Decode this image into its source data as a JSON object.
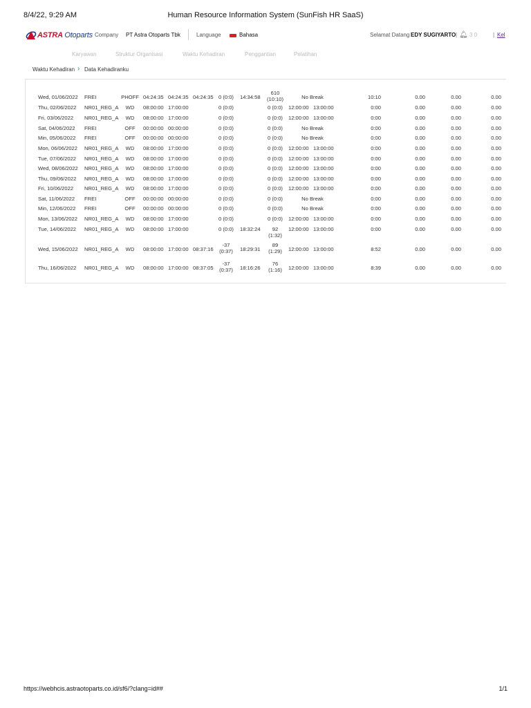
{
  "print": {
    "datetime": "8/4/22, 9:29 AM",
    "title": "Human Resource Information System (SunFish HR SaaS)",
    "url": "https://webhcis.astraotoparts.co.id/sf6/?clang=id##",
    "page": "1/1"
  },
  "header": {
    "logo_brand": "ASTRA",
    "logo_product": "Otoparts",
    "company_label": "Company",
    "company_value": "PT Astra Otoparts Tbk",
    "language_label": "Language",
    "language_value": "Bahasa",
    "welcome_label": "Selamat Datang",
    "user_name": "EDY SUGIYARTO",
    "notification_count": "3 0",
    "logout_label": "Kel"
  },
  "nav": {
    "items": [
      "Karyawan",
      "Struktur Organisasi",
      "Waktu Kehadiran",
      "Penggantian",
      "Pelatihan"
    ]
  },
  "breadcrumb": {
    "parent": "Waktu Kehadiran",
    "current": "Data Kehadiranku"
  },
  "attendance": {
    "rows": [
      {
        "date": "Wed, 01/06/2022",
        "shift": "FREI",
        "type": "PHOFF",
        "start": "04:24:35",
        "end": "04:24:35",
        "in": "04:24:35",
        "late": "0 (0:0)",
        "out": "14:34:58",
        "early_1": "610",
        "early_2": "(10:10)",
        "break_start": "No Break",
        "break_end": "",
        "work": "10:10",
        "ot1": "0.00",
        "ot2": "0.00",
        "ot3": "0.00"
      },
      {
        "date": "Thu, 02/06/2022",
        "shift": "NR01_REG_A",
        "type": "WD",
        "start": "08:00:00",
        "end": "17:00:00",
        "in": "",
        "late": "0 (0:0)",
        "out": "",
        "early_1": "0 (0:0)",
        "early_2": "",
        "break_start": "12:00:00",
        "break_end": "13:00:00",
        "work": "0:00",
        "ot1": "0.00",
        "ot2": "0.00",
        "ot3": "0.00"
      },
      {
        "date": "Fri, 03/06/2022",
        "shift": "NR01_REG_A",
        "type": "WD",
        "start": "08:00:00",
        "end": "17:00:00",
        "in": "",
        "late": "0 (0:0)",
        "out": "",
        "early_1": "0 (0:0)",
        "early_2": "",
        "break_start": "12:00:00",
        "break_end": "13:00:00",
        "work": "0:00",
        "ot1": "0.00",
        "ot2": "0.00",
        "ot3": "0.00"
      },
      {
        "date": "Sat, 04/06/2022",
        "shift": "FREI",
        "type": "OFF",
        "start": "00:00:00",
        "end": "00:00:00",
        "in": "",
        "late": "0 (0:0)",
        "out": "",
        "early_1": "0 (0:0)",
        "early_2": "",
        "break_start": "No Break",
        "break_end": "",
        "work": "0:00",
        "ot1": "0.00",
        "ot2": "0.00",
        "ot3": "0.00"
      },
      {
        "date": "Min, 05/06/2022",
        "shift": "FREI",
        "type": "OFF",
        "start": "00:00:00",
        "end": "00:00:00",
        "in": "",
        "late": "0 (0:0)",
        "out": "",
        "early_1": "0 (0:0)",
        "early_2": "",
        "break_start": "No Break",
        "break_end": "",
        "work": "0:00",
        "ot1": "0.00",
        "ot2": "0.00",
        "ot3": "0.00"
      },
      {
        "date": "Mon, 06/06/2022",
        "shift": "NR01_REG_A",
        "type": "WD",
        "start": "08:00:00",
        "end": "17:00:00",
        "in": "",
        "late": "0 (0:0)",
        "out": "",
        "early_1": "0 (0:0)",
        "early_2": "",
        "break_start": "12:00:00",
        "break_end": "13:00:00",
        "work": "0:00",
        "ot1": "0.00",
        "ot2": "0.00",
        "ot3": "0.00"
      },
      {
        "date": "Tue, 07/06/2022",
        "shift": "NR01_REG_A",
        "type": "WD",
        "start": "08:00:00",
        "end": "17:00:00",
        "in": "",
        "late": "0 (0:0)",
        "out": "",
        "early_1": "0 (0:0)",
        "early_2": "",
        "break_start": "12:00:00",
        "break_end": "13:00:00",
        "work": "0:00",
        "ot1": "0.00",
        "ot2": "0.00",
        "ot3": "0.00"
      },
      {
        "date": "Wed, 08/06/2022",
        "shift": "NR01_REG_A",
        "type": "WD",
        "start": "08:00:00",
        "end": "17:00:00",
        "in": "",
        "late": "0 (0:0)",
        "out": "",
        "early_1": "0 (0:0)",
        "early_2": "",
        "break_start": "12:00:00",
        "break_end": "13:00:00",
        "work": "0:00",
        "ot1": "0.00",
        "ot2": "0.00",
        "ot3": "0.00"
      },
      {
        "date": "Thu, 09/06/2022",
        "shift": "NR01_REG_A",
        "type": "WD",
        "start": "08:00:00",
        "end": "17:00:00",
        "in": "",
        "late": "0 (0:0)",
        "out": "",
        "early_1": "0 (0:0)",
        "early_2": "",
        "break_start": "12:00:00",
        "break_end": "13:00:00",
        "work": "0:00",
        "ot1": "0.00",
        "ot2": "0.00",
        "ot3": "0.00"
      },
      {
        "date": "Fri, 10/06/2022",
        "shift": "NR01_REG_A",
        "type": "WD",
        "start": "08:00:00",
        "end": "17:00:00",
        "in": "",
        "late": "0 (0:0)",
        "out": "",
        "early_1": "0 (0:0)",
        "early_2": "",
        "break_start": "12:00:00",
        "break_end": "13:00:00",
        "work": "0:00",
        "ot1": "0.00",
        "ot2": "0.00",
        "ot3": "0.00"
      },
      {
        "date": "Sat, 11/06/2022",
        "shift": "FREI",
        "type": "OFF",
        "start": "00:00:00",
        "end": "00:00:00",
        "in": "",
        "late": "0 (0:0)",
        "out": "",
        "early_1": "0 (0:0)",
        "early_2": "",
        "break_start": "No Break",
        "break_end": "",
        "work": "0:00",
        "ot1": "0.00",
        "ot2": "0.00",
        "ot3": "0.00"
      },
      {
        "date": "Min, 12/06/2022",
        "shift": "FREI",
        "type": "OFF",
        "start": "00:00:00",
        "end": "00:00:00",
        "in": "",
        "late": "0 (0:0)",
        "out": "",
        "early_1": "0 (0:0)",
        "early_2": "",
        "break_start": "No Break",
        "break_end": "",
        "work": "0:00",
        "ot1": "0.00",
        "ot2": "0.00",
        "ot3": "0.00"
      },
      {
        "date": "Mon, 13/06/2022",
        "shift": "NR01_REG_A",
        "type": "WD",
        "start": "08:00:00",
        "end": "17:00:00",
        "in": "",
        "late": "0 (0:0)",
        "out": "",
        "early_1": "0 (0:0)",
        "early_2": "",
        "break_start": "12:00:00",
        "break_end": "13:00:00",
        "work": "0:00",
        "ot1": "0.00",
        "ot2": "0.00",
        "ot3": "0.00"
      },
      {
        "date": "Tue, 14/06/2022",
        "shift": "NR01_REG_A",
        "type": "WD",
        "start": "08:00:00",
        "end": "17:00:00",
        "in": "",
        "late": "0 (0:0)",
        "out": "18:32:24",
        "early_1": "92",
        "early_2": "(1:32)",
        "break_start": "12:00:00",
        "break_end": "13:00:00",
        "work": "0:00",
        "ot1": "0.00",
        "ot2": "0.00",
        "ot3": "0.00"
      },
      {
        "date": "Wed, 15/06/2022",
        "shift": "NR01_REG_A",
        "type": "WD",
        "start": "08:00:00",
        "end": "17:00:00",
        "in": "08:37:16",
        "late": "-37",
        "late_2": "(0:37)",
        "out": "18:29:31",
        "early_1": "89",
        "early_2": "(1:29)",
        "break_start": "12:00:00",
        "break_end": "13:00:00",
        "work": "8:52",
        "ot1": "0.00",
        "ot2": "0.00",
        "ot3": "0.00"
      },
      {
        "date": "Thu, 16/06/2022",
        "shift": "NR01_REG_A",
        "type": "WD",
        "start": "08:00:00",
        "end": "17:00:00",
        "in": "08:37:05",
        "late": "-37",
        "late_2": "(0:37)",
        "out": "18:16:26",
        "early_1": "76",
        "early_2": "(1:16)",
        "break_start": "12:00:00",
        "break_end": "13:00:00",
        "work": "8:39",
        "ot1": "0.00",
        "ot2": "0.00",
        "ot3": "0.00"
      }
    ]
  }
}
